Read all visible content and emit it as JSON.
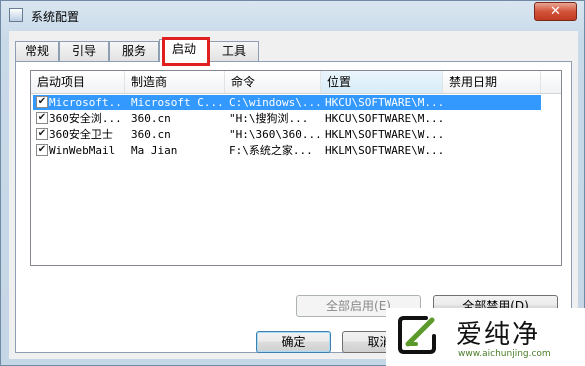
{
  "window": {
    "title": "系统配置",
    "close_label": "✕"
  },
  "tabs": [
    {
      "label": "常规"
    },
    {
      "label": "引导"
    },
    {
      "label": "服务"
    },
    {
      "label": "启动",
      "active": true
    },
    {
      "label": "工具"
    }
  ],
  "list": {
    "columns": [
      "启动项目",
      "制造商",
      "命令",
      "位置",
      "禁用日期"
    ],
    "rows": [
      {
        "checked": true,
        "item": "Microsoft...",
        "maker": "Microsoft C...",
        "command": "C:\\windows\\...",
        "location": "HKCU\\SOFTWARE\\M...",
        "disabled_date": "",
        "selected": true
      },
      {
        "checked": true,
        "item": "360安全浏...",
        "maker": "360.cn",
        "command": "\"H:\\搜狗浏...",
        "location": "HKCU\\SOFTWARE\\M...",
        "disabled_date": ""
      },
      {
        "checked": true,
        "item": "360安全卫士",
        "maker": "360.cn",
        "command": "\"H:\\360\\360...",
        "location": "HKLM\\SOFTWARE\\W...",
        "disabled_date": ""
      },
      {
        "checked": true,
        "item": "WinWebMail",
        "maker": "Ma Jian",
        "command": "F:\\系统之家...",
        "location": "HKLM\\SOFTWARE\\W...",
        "disabled_date": ""
      }
    ]
  },
  "buttons": {
    "enable_all": "全部启用(E)",
    "disable_all": "全部禁用(D)",
    "ok": "确定",
    "cancel": "取消"
  },
  "watermark": {
    "text": "爱纯净",
    "url": "www.aichunjing.com"
  },
  "colors": {
    "selection": "#3399ff",
    "highlight_box": "#e02020",
    "watermark_green": "#4a7d2a"
  }
}
